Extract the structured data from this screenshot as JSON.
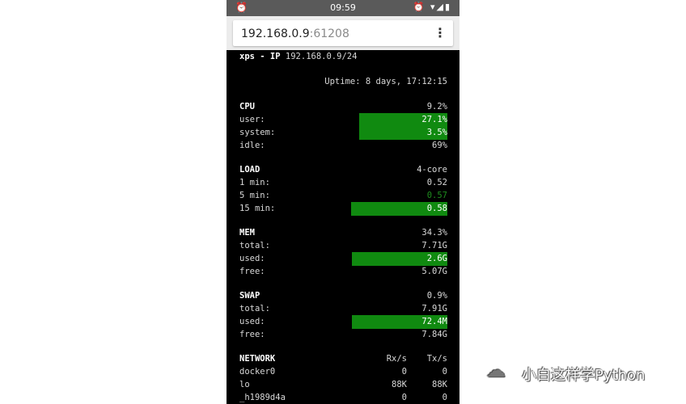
{
  "statusbar": {
    "time": "09:59",
    "alarm_icon": "alarm-icon",
    "status_icons": "wifi-signal-battery"
  },
  "browser": {
    "url_host": "192.168.0.9",
    "url_port": ":61208"
  },
  "header": {
    "host_label": "xps",
    "sep": " - IP ",
    "ip": "192.168.0.9/24",
    "uptime": "Uptime: 8 days, 17:12:15"
  },
  "cpu": {
    "title": "CPU",
    "total": "9.2%",
    "user_label": "user:",
    "user": "27.1%",
    "system_label": "system:",
    "system": "3.5%",
    "idle_label": "idle:",
    "idle": "69%"
  },
  "load": {
    "title": "LOAD",
    "cores": "4-core",
    "m1_label": "1 min:",
    "m1": "0.52",
    "m5_label": "5 min:",
    "m5": "0.57",
    "m15_label": "15 min:",
    "m15": "0.58"
  },
  "mem": {
    "title": "MEM",
    "percent": "34.3%",
    "total_label": "total:",
    "total": "7.71G",
    "used_label": "used:",
    "used": "2.6G",
    "free_label": "free:",
    "free": "5.07G"
  },
  "swap": {
    "title": "SWAP",
    "percent": "0.9%",
    "total_label": "total:",
    "total": "7.91G",
    "used_label": "used:",
    "used": "72.4M",
    "free_label": "free:",
    "free": "7.84G"
  },
  "network": {
    "title": "NETWORK",
    "rx_header": "Rx/s",
    "tx_header": "Tx/s",
    "rows": [
      {
        "name": "docker0",
        "rx": "0",
        "tx": "0"
      },
      {
        "name": "lo",
        "rx": "88K",
        "tx": "88K"
      },
      {
        "name": "_h1989d4a",
        "rx": "0",
        "tx": "0"
      }
    ]
  },
  "watermark": {
    "text": "小白这样学Python"
  },
  "colors": {
    "bar_green": "#108a10",
    "load_text_green": "#1e8c1e",
    "terminal_bg": "#000000"
  }
}
